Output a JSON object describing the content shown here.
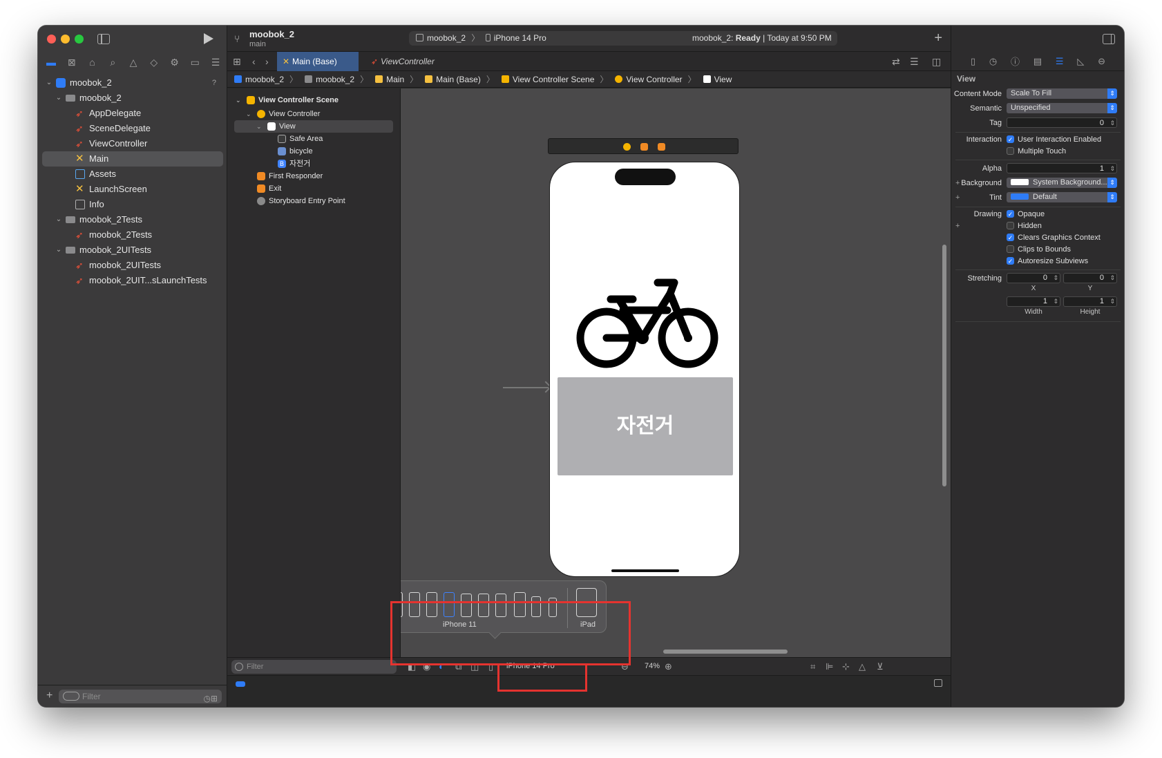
{
  "navigator": {
    "toolbar_icons": [
      "folder-icon",
      "source-control-icon",
      "symbol-icon",
      "find-icon",
      "issue-icon",
      "test-icon",
      "debug-icon",
      "breakpoint-icon",
      "report-icon"
    ],
    "tree": [
      {
        "label": "moobok_2",
        "icon": "project",
        "indent": 0,
        "disclosure": "open",
        "badge": "?"
      },
      {
        "label": "moobok_2",
        "icon": "folder",
        "indent": 1,
        "disclosure": "open"
      },
      {
        "label": "AppDelegate",
        "icon": "swift",
        "indent": 2
      },
      {
        "label": "SceneDelegate",
        "icon": "swift",
        "indent": 2
      },
      {
        "label": "ViewController",
        "icon": "swift",
        "indent": 2
      },
      {
        "label": "Main",
        "icon": "storyboard",
        "indent": 2,
        "selected": true
      },
      {
        "label": "Assets",
        "icon": "assets",
        "indent": 2
      },
      {
        "label": "LaunchScreen",
        "icon": "storyboard",
        "indent": 2
      },
      {
        "label": "Info",
        "icon": "info",
        "indent": 2
      },
      {
        "label": "moobok_2Tests",
        "icon": "folder",
        "indent": 1,
        "disclosure": "open"
      },
      {
        "label": "moobok_2Tests",
        "icon": "swift",
        "indent": 2
      },
      {
        "label": "moobok_2UITests",
        "icon": "folder",
        "indent": 1,
        "disclosure": "open"
      },
      {
        "label": "moobok_2UITests",
        "icon": "swift",
        "indent": 2
      },
      {
        "label": "moobok_2UIT...sLaunchTests",
        "icon": "swift",
        "indent": 2
      }
    ],
    "filter_placeholder": "Filter"
  },
  "toolbar": {
    "project_name": "moobok_2",
    "branch": "main",
    "scheme": "moobok_2",
    "destination": "iPhone 14 Pro",
    "status_prefix": "moobok_2: ",
    "status_state": "Ready",
    "status_suffix": " | Today at 9:50 PM"
  },
  "tabs": [
    {
      "label": "Main (Base)",
      "active": true
    },
    {
      "label": "ViewController",
      "active": false
    }
  ],
  "breadcrumbs": [
    "moobok_2",
    "moobok_2",
    "Main",
    "Main (Base)",
    "View Controller Scene",
    "View Controller",
    "View"
  ],
  "outline": [
    {
      "label": "View Controller Scene",
      "indent": 0,
      "disclosure": "open",
      "bold": true,
      "icon_color": "#f5b400"
    },
    {
      "label": "View Controller",
      "indent": 1,
      "disclosure": "open",
      "icon_color": "#f5b400",
      "round": true
    },
    {
      "label": "View",
      "indent": 2,
      "disclosure": "open",
      "icon_color": "#ffffff",
      "selected": true
    },
    {
      "label": "Safe Area",
      "indent": 3,
      "icon_color": "#3a3a3a",
      "border": true
    },
    {
      "label": "bicycle",
      "indent": 3,
      "icon_color": "#6a8fd0"
    },
    {
      "label": "자전거",
      "indent": 3,
      "icon_color": "#3f83ff",
      "glyph": "B"
    },
    {
      "label": "First Responder",
      "indent": 1,
      "icon_color": "#f08a24"
    },
    {
      "label": "Exit",
      "indent": 1,
      "icon_color": "#f08a24"
    },
    {
      "label": "Storyboard Entry Point",
      "indent": 1,
      "icon_color": "#8a8a8a",
      "round": true
    }
  ],
  "canvas": {
    "button_title": "자전거",
    "device_popover": {
      "devices": [
        {
          "w": 16,
          "h": 36
        },
        {
          "w": 16,
          "h": 36
        },
        {
          "w": 16,
          "h": 36
        },
        {
          "w": 16,
          "h": 36,
          "selected": true
        },
        {
          "w": 16,
          "h": 34
        },
        {
          "w": 16,
          "h": 34
        },
        {
          "w": 16,
          "h": 34
        },
        {
          "w": 17,
          "h": 36
        },
        {
          "w": 14,
          "h": 30
        },
        {
          "w": 12,
          "h": 28
        }
      ],
      "selected_label": "iPhone 11",
      "ipad_label": "iPad"
    },
    "filter_placeholder": "Filter",
    "device_label": "iPhone 14 Pro",
    "zoom": "74%"
  },
  "inspector": {
    "section_title": "View",
    "content_mode": {
      "label": "Content Mode",
      "value": "Scale To Fill"
    },
    "semantic": {
      "label": "Semantic",
      "value": "Unspecified"
    },
    "tag": {
      "label": "Tag",
      "value": "0"
    },
    "interaction": {
      "label": "Interaction",
      "options": [
        {
          "label": "User Interaction Enabled",
          "checked": true
        },
        {
          "label": "Multiple Touch",
          "checked": false
        }
      ]
    },
    "alpha": {
      "label": "Alpha",
      "value": "1"
    },
    "background": {
      "label": "Background",
      "value": "System Background...",
      "swatch": "#ffffff"
    },
    "tint": {
      "label": "Tint",
      "value": "Default",
      "swatch": "#2f7cf6"
    },
    "drawing": {
      "label": "Drawing",
      "options": [
        {
          "label": "Opaque",
          "checked": true
        },
        {
          "label": "Hidden",
          "checked": false
        },
        {
          "label": "Clears Graphics Context",
          "checked": true
        },
        {
          "label": "Clips to Bounds",
          "checked": false
        },
        {
          "label": "Autoresize Subviews",
          "checked": true
        }
      ]
    },
    "stretching": {
      "label": "Stretching",
      "x": "0",
      "y": "0",
      "width": "1",
      "height": "1",
      "x_label": "X",
      "y_label": "Y",
      "width_label": "Width",
      "height_label": "Height"
    }
  },
  "colors": {
    "accent": "#2f7cf6",
    "highlight": "#e5332f",
    "button_bg": "#afafb2"
  }
}
